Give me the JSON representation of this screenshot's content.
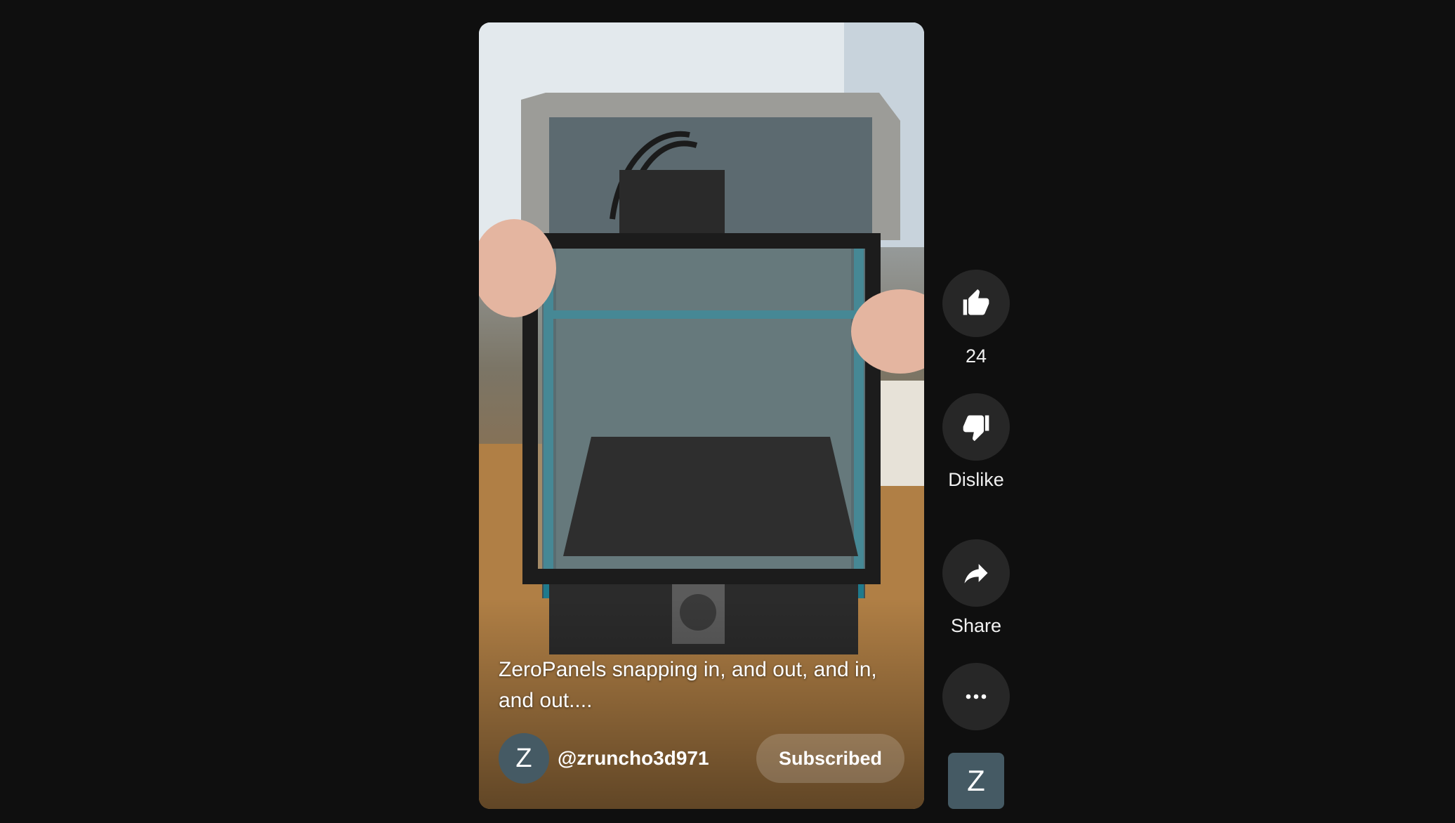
{
  "video": {
    "title": "ZeroPanels snapping in, and out, and in, and out....",
    "channel_avatar_letter": "Z",
    "channel_handle": "@zruncho3d971",
    "subscribe_label": "Subscribed"
  },
  "actions": {
    "like_count": "24",
    "dislike_label": "Dislike",
    "share_label": "Share"
  },
  "side_avatar_letter": "Z",
  "icons": {
    "like": "thumbs-up-icon",
    "dislike": "thumbs-down-icon",
    "share": "share-arrow-icon",
    "more": "more-horizontal-icon"
  },
  "colors": {
    "background": "#0f0f0f",
    "action_button": "#272727",
    "avatar": "#455a64"
  }
}
